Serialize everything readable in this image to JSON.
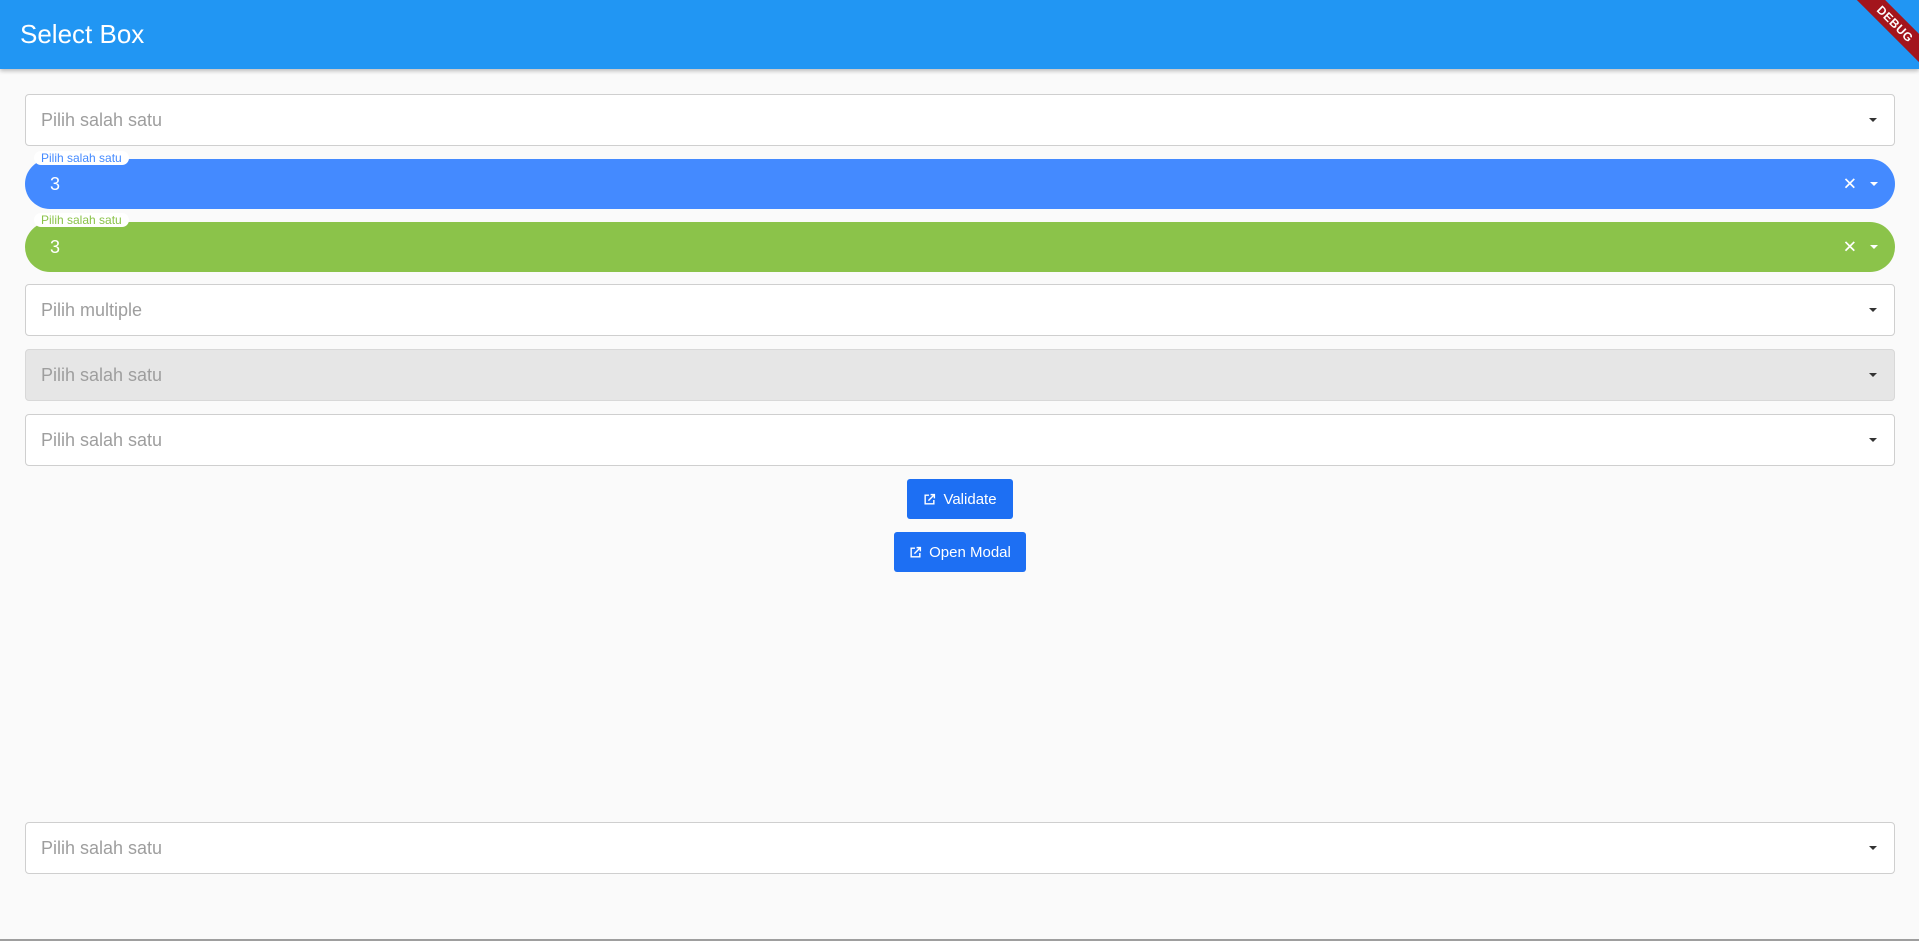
{
  "app": {
    "title": "Select Box",
    "debug_label": "DEBUG"
  },
  "colors": {
    "appbar": "#2196f3",
    "pill_blue": "#448aff",
    "pill_green": "#8bc34a",
    "button": "#1d6ff3"
  },
  "fields": {
    "select1": {
      "placeholder": "Pilih salah satu"
    },
    "select_blue": {
      "label": "Pilih salah satu",
      "value": "3",
      "clear_icon": "close-icon"
    },
    "select_green": {
      "label": "Pilih salah satu",
      "value": "3",
      "clear_icon": "close-icon"
    },
    "select_multiple": {
      "placeholder": "Pilih multiple"
    },
    "select_disabled": {
      "placeholder": "Pilih salah satu"
    },
    "select6": {
      "placeholder": "Pilih salah satu"
    },
    "select_bottom": {
      "placeholder": "Pilih salah satu"
    }
  },
  "buttons": {
    "validate": {
      "label": "Validate",
      "icon": "open-in-new-icon"
    },
    "open_modal": {
      "label": "Open Modal",
      "icon": "open-in-new-icon"
    }
  }
}
